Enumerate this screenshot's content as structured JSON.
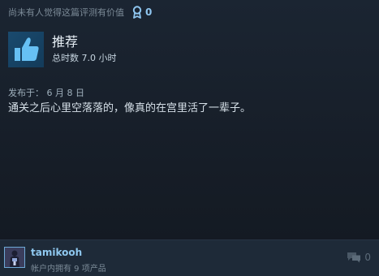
{
  "review": {
    "helpful_text": "尚未有人觉得这篇评测有价值",
    "award_count": "0",
    "recommendation": "推荐",
    "hours": "总时数 7.0 小时",
    "posted": "发布于：  6 月 8 日",
    "body": "通关之后心里空落落的，像真的在宫里活了一辈子。"
  },
  "author": {
    "name": "tamikooh",
    "products": "帐户内拥有 9 项产品"
  },
  "comments": {
    "count": "0"
  },
  "colors": {
    "background": "#171d25",
    "accent": "#8fc6f0",
    "thumb_box": "#1a4a6e",
    "thumb": "#66c0f4"
  }
}
